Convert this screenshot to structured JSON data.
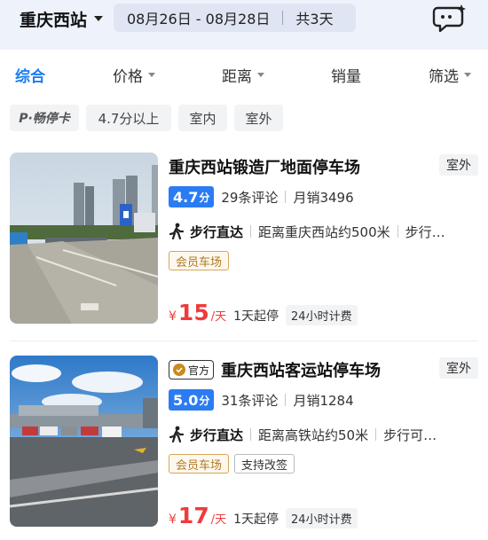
{
  "header": {
    "station": "重庆西站",
    "dates": "08月26日 - 08月28日",
    "total": "共3天",
    "chat_icon": "chat-sparkle-icon"
  },
  "tabs": [
    {
      "label": "综合",
      "active": true
    },
    {
      "label": "价格",
      "has_caret": true
    },
    {
      "label": "距离",
      "has_caret": true
    },
    {
      "label": "销量"
    },
    {
      "label": "筛选",
      "has_caret": true
    }
  ],
  "chips": [
    "P·畅停卡",
    "4.7分以上",
    "室内",
    "室外"
  ],
  "listings": [
    {
      "title": "重庆西站锻造厂地面停车场",
      "type": "室外",
      "score": "4.7",
      "score_unit": "分",
      "reviews": "29条评论",
      "monthly": "月销3496",
      "walk_label": "步行直达",
      "distance": "距离重庆西站约500米",
      "walk_extra": "步行…",
      "tags": [
        {
          "text": "会员车场",
          "style": "gold"
        }
      ],
      "currency": "¥",
      "price": "15",
      "price_unit": "/天",
      "min_stay": "1天起停",
      "billing": "24小时计费"
    },
    {
      "official": "官方",
      "title": "重庆西站客运站停车场",
      "type": "室外",
      "score": "5.0",
      "score_unit": "分",
      "reviews": "31条评论",
      "monthly": "月销1284",
      "walk_label": "步行直达",
      "distance": "距离高铁站约50米",
      "walk_extra": "步行可…",
      "tags": [
        {
          "text": "会员车场",
          "style": "gold"
        },
        {
          "text": "支持改签",
          "style": "grey"
        }
      ],
      "currency": "¥",
      "price": "17",
      "price_unit": "/天",
      "min_stay": "1天起停",
      "billing": "24小时计费"
    }
  ],
  "colors": {
    "accent": "#1a7df0",
    "score_badge": "#2b7cf3",
    "price": "#ef3b3b",
    "member_tag": "#b07a23"
  }
}
